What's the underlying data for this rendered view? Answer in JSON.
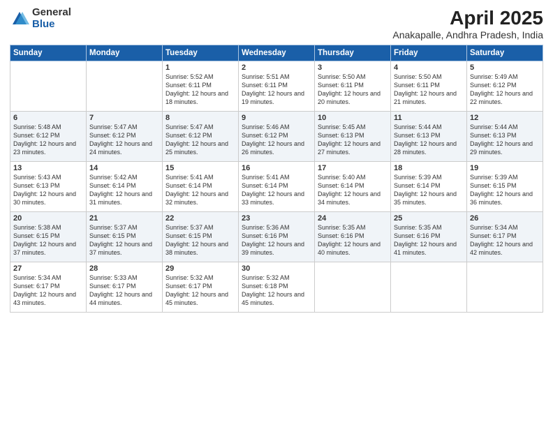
{
  "logo": {
    "general": "General",
    "blue": "Blue"
  },
  "title": "April 2025",
  "subtitle": "Anakapalle, Andhra Pradesh, India",
  "days": [
    "Sunday",
    "Monday",
    "Tuesday",
    "Wednesday",
    "Thursday",
    "Friday",
    "Saturday"
  ],
  "weeks": [
    [
      {
        "num": "",
        "sr": "",
        "ss": "",
        "dl": ""
      },
      {
        "num": "",
        "sr": "",
        "ss": "",
        "dl": ""
      },
      {
        "num": "1",
        "sr": "Sunrise: 5:52 AM",
        "ss": "Sunset: 6:11 PM",
        "dl": "Daylight: 12 hours and 18 minutes."
      },
      {
        "num": "2",
        "sr": "Sunrise: 5:51 AM",
        "ss": "Sunset: 6:11 PM",
        "dl": "Daylight: 12 hours and 19 minutes."
      },
      {
        "num": "3",
        "sr": "Sunrise: 5:50 AM",
        "ss": "Sunset: 6:11 PM",
        "dl": "Daylight: 12 hours and 20 minutes."
      },
      {
        "num": "4",
        "sr": "Sunrise: 5:50 AM",
        "ss": "Sunset: 6:11 PM",
        "dl": "Daylight: 12 hours and 21 minutes."
      },
      {
        "num": "5",
        "sr": "Sunrise: 5:49 AM",
        "ss": "Sunset: 6:12 PM",
        "dl": "Daylight: 12 hours and 22 minutes."
      }
    ],
    [
      {
        "num": "6",
        "sr": "Sunrise: 5:48 AM",
        "ss": "Sunset: 6:12 PM",
        "dl": "Daylight: 12 hours and 23 minutes."
      },
      {
        "num": "7",
        "sr": "Sunrise: 5:47 AM",
        "ss": "Sunset: 6:12 PM",
        "dl": "Daylight: 12 hours and 24 minutes."
      },
      {
        "num": "8",
        "sr": "Sunrise: 5:47 AM",
        "ss": "Sunset: 6:12 PM",
        "dl": "Daylight: 12 hours and 25 minutes."
      },
      {
        "num": "9",
        "sr": "Sunrise: 5:46 AM",
        "ss": "Sunset: 6:12 PM",
        "dl": "Daylight: 12 hours and 26 minutes."
      },
      {
        "num": "10",
        "sr": "Sunrise: 5:45 AM",
        "ss": "Sunset: 6:13 PM",
        "dl": "Daylight: 12 hours and 27 minutes."
      },
      {
        "num": "11",
        "sr": "Sunrise: 5:44 AM",
        "ss": "Sunset: 6:13 PM",
        "dl": "Daylight: 12 hours and 28 minutes."
      },
      {
        "num": "12",
        "sr": "Sunrise: 5:44 AM",
        "ss": "Sunset: 6:13 PM",
        "dl": "Daylight: 12 hours and 29 minutes."
      }
    ],
    [
      {
        "num": "13",
        "sr": "Sunrise: 5:43 AM",
        "ss": "Sunset: 6:13 PM",
        "dl": "Daylight: 12 hours and 30 minutes."
      },
      {
        "num": "14",
        "sr": "Sunrise: 5:42 AM",
        "ss": "Sunset: 6:14 PM",
        "dl": "Daylight: 12 hours and 31 minutes."
      },
      {
        "num": "15",
        "sr": "Sunrise: 5:41 AM",
        "ss": "Sunset: 6:14 PM",
        "dl": "Daylight: 12 hours and 32 minutes."
      },
      {
        "num": "16",
        "sr": "Sunrise: 5:41 AM",
        "ss": "Sunset: 6:14 PM",
        "dl": "Daylight: 12 hours and 33 minutes."
      },
      {
        "num": "17",
        "sr": "Sunrise: 5:40 AM",
        "ss": "Sunset: 6:14 PM",
        "dl": "Daylight: 12 hours and 34 minutes."
      },
      {
        "num": "18",
        "sr": "Sunrise: 5:39 AM",
        "ss": "Sunset: 6:14 PM",
        "dl": "Daylight: 12 hours and 35 minutes."
      },
      {
        "num": "19",
        "sr": "Sunrise: 5:39 AM",
        "ss": "Sunset: 6:15 PM",
        "dl": "Daylight: 12 hours and 36 minutes."
      }
    ],
    [
      {
        "num": "20",
        "sr": "Sunrise: 5:38 AM",
        "ss": "Sunset: 6:15 PM",
        "dl": "Daylight: 12 hours and 37 minutes."
      },
      {
        "num": "21",
        "sr": "Sunrise: 5:37 AM",
        "ss": "Sunset: 6:15 PM",
        "dl": "Daylight: 12 hours and 37 minutes."
      },
      {
        "num": "22",
        "sr": "Sunrise: 5:37 AM",
        "ss": "Sunset: 6:15 PM",
        "dl": "Daylight: 12 hours and 38 minutes."
      },
      {
        "num": "23",
        "sr": "Sunrise: 5:36 AM",
        "ss": "Sunset: 6:16 PM",
        "dl": "Daylight: 12 hours and 39 minutes."
      },
      {
        "num": "24",
        "sr": "Sunrise: 5:35 AM",
        "ss": "Sunset: 6:16 PM",
        "dl": "Daylight: 12 hours and 40 minutes."
      },
      {
        "num": "25",
        "sr": "Sunrise: 5:35 AM",
        "ss": "Sunset: 6:16 PM",
        "dl": "Daylight: 12 hours and 41 minutes."
      },
      {
        "num": "26",
        "sr": "Sunrise: 5:34 AM",
        "ss": "Sunset: 6:17 PM",
        "dl": "Daylight: 12 hours and 42 minutes."
      }
    ],
    [
      {
        "num": "27",
        "sr": "Sunrise: 5:34 AM",
        "ss": "Sunset: 6:17 PM",
        "dl": "Daylight: 12 hours and 43 minutes."
      },
      {
        "num": "28",
        "sr": "Sunrise: 5:33 AM",
        "ss": "Sunset: 6:17 PM",
        "dl": "Daylight: 12 hours and 44 minutes."
      },
      {
        "num": "29",
        "sr": "Sunrise: 5:32 AM",
        "ss": "Sunset: 6:17 PM",
        "dl": "Daylight: 12 hours and 45 minutes."
      },
      {
        "num": "30",
        "sr": "Sunrise: 5:32 AM",
        "ss": "Sunset: 6:18 PM",
        "dl": "Daylight: 12 hours and 45 minutes."
      },
      {
        "num": "",
        "sr": "",
        "ss": "",
        "dl": ""
      },
      {
        "num": "",
        "sr": "",
        "ss": "",
        "dl": ""
      },
      {
        "num": "",
        "sr": "",
        "ss": "",
        "dl": ""
      }
    ]
  ]
}
